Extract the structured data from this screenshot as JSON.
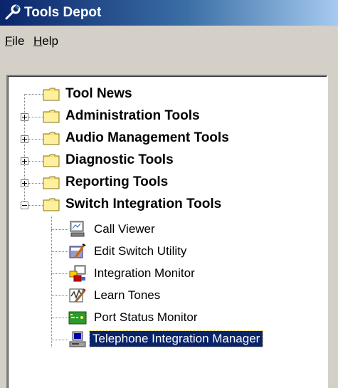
{
  "window": {
    "title": "Tools Depot",
    "icon": "wrench-icon"
  },
  "menu": [
    {
      "label": "File",
      "accel": "F",
      "rest": "ile"
    },
    {
      "label": "Help",
      "accel": "H",
      "rest": "elp"
    }
  ],
  "tree": {
    "folders": [
      {
        "label": "Tool News",
        "expander": "none"
      },
      {
        "label": "Administration Tools",
        "expander": "+"
      },
      {
        "label": "Audio Management Tools",
        "expander": "+"
      },
      {
        "label": "Diagnostic Tools",
        "expander": "+"
      },
      {
        "label": "Reporting Tools",
        "expander": "+"
      },
      {
        "label": "Switch Integration Tools",
        "expander": "-"
      }
    ],
    "tools": [
      {
        "label": "Call Viewer",
        "icon": "call-viewer-icon"
      },
      {
        "label": "Edit Switch Utility",
        "icon": "edit-switch-icon"
      },
      {
        "label": "Integration Monitor",
        "icon": "integration-monitor-icon"
      },
      {
        "label": "Learn Tones",
        "icon": "learn-tones-icon"
      },
      {
        "label": "Port Status Monitor",
        "icon": "port-status-icon"
      },
      {
        "label": "Telephone Integration Manager",
        "icon": "telephone-manager-icon",
        "selected": true
      }
    ]
  },
  "colors": {
    "titlebar_start": "#0a246a",
    "titlebar_end": "#a6caf0",
    "selection": "#0a246a",
    "window_bg": "#d4d0c8"
  }
}
